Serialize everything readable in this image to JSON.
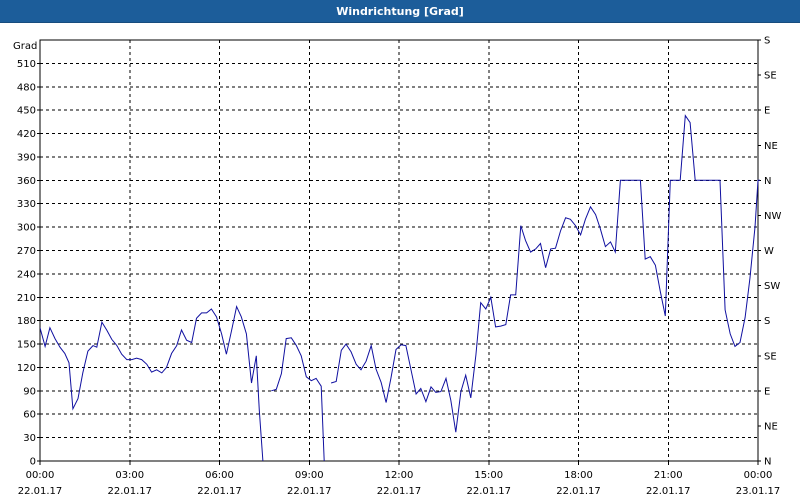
{
  "window": {
    "title": "Windrichtung [Grad]"
  },
  "chart_data": {
    "type": "line",
    "title": "Windrichtung [Grad]",
    "ylabel": "Grad",
    "xlim": [
      "22.01.17 00:00",
      "23.01.17 00:00"
    ],
    "ylim": [
      0,
      540
    ],
    "yticks": [
      0,
      30,
      60,
      90,
      120,
      150,
      180,
      210,
      240,
      270,
      300,
      330,
      360,
      390,
      420,
      450,
      480,
      510
    ],
    "y2ticks": [
      {
        "value": 0,
        "label": "N"
      },
      {
        "value": 45,
        "label": "NE"
      },
      {
        "value": 90,
        "label": "E"
      },
      {
        "value": 135,
        "label": "SE"
      },
      {
        "value": 180,
        "label": "S"
      },
      {
        "value": 225,
        "label": "SW"
      },
      {
        "value": 270,
        "label": "W"
      },
      {
        "value": 315,
        "label": "NW"
      },
      {
        "value": 360,
        "label": "N"
      },
      {
        "value": 405,
        "label": "NE"
      },
      {
        "value": 450,
        "label": "E"
      },
      {
        "value": 495,
        "label": "SE"
      },
      {
        "value": 540,
        "label": "S"
      }
    ],
    "xticks": [
      {
        "hour": 0,
        "time": "00:00",
        "date": "22.01.17"
      },
      {
        "hour": 3,
        "time": "03:00",
        "date": "22.01.17"
      },
      {
        "hour": 6,
        "time": "06:00",
        "date": "22.01.17"
      },
      {
        "hour": 9,
        "time": "09:00",
        "date": "22.01.17"
      },
      {
        "hour": 12,
        "time": "12:00",
        "date": "22.01.17"
      },
      {
        "hour": 15,
        "time": "15:00",
        "date": "22.01.17"
      },
      {
        "hour": 18,
        "time": "18:00",
        "date": "22.01.17"
      },
      {
        "hour": 21,
        "time": "21:00",
        "date": "22.01.17"
      },
      {
        "hour": 24,
        "time": "00:00",
        "date": "23.01.17"
      }
    ],
    "grid": true,
    "line_color": "#1010a0",
    "series": [
      {
        "segments": [
          [
            [
              0.0,
              171
            ],
            [
              0.17,
              147
            ],
            [
              0.33,
              171
            ],
            [
              0.5,
              157
            ],
            [
              0.67,
              146
            ],
            [
              0.83,
              138
            ],
            [
              0.97,
              126
            ],
            [
              1.1,
              67
            ],
            [
              1.27,
              80
            ],
            [
              1.43,
              113
            ],
            [
              1.6,
              141
            ],
            [
              1.77,
              148
            ],
            [
              1.9,
              146
            ],
            [
              2.07,
              178
            ],
            [
              2.23,
              168
            ],
            [
              2.4,
              156
            ],
            [
              2.57,
              148
            ],
            [
              2.73,
              137
            ],
            [
              2.9,
              130
            ],
            [
              3.07,
              130
            ],
            [
              3.23,
              132
            ],
            [
              3.4,
              130
            ],
            [
              3.57,
              124
            ],
            [
              3.73,
              114
            ],
            [
              3.9,
              117
            ],
            [
              4.07,
              113
            ],
            [
              4.23,
              120
            ],
            [
              4.4,
              138
            ],
            [
              4.57,
              148
            ],
            [
              4.73,
              168
            ],
            [
              4.9,
              155
            ],
            [
              5.07,
              152
            ],
            [
              5.23,
              183
            ],
            [
              5.4,
              190
            ],
            [
              5.57,
              190
            ],
            [
              5.73,
              195
            ],
            [
              5.9,
              185
            ],
            [
              6.07,
              163
            ],
            [
              6.23,
              137
            ],
            [
              6.4,
              167
            ],
            [
              6.57,
              198
            ],
            [
              6.73,
              185
            ],
            [
              6.9,
              163
            ],
            [
              7.07,
              100
            ],
            [
              7.23,
              135
            ],
            [
              7.33,
              65
            ],
            [
              7.45,
              0
            ]
          ],
          [
            [
              7.73,
              90
            ],
            [
              7.9,
              92
            ],
            [
              8.07,
              112
            ],
            [
              8.23,
              157
            ],
            [
              8.4,
              158
            ],
            [
              8.57,
              148
            ],
            [
              8.73,
              135
            ],
            [
              8.9,
              108
            ],
            [
              9.07,
              103
            ],
            [
              9.23,
              106
            ],
            [
              9.4,
              96
            ],
            [
              9.5,
              0
            ]
          ],
          [
            [
              9.73,
              100
            ],
            [
              9.9,
              102
            ],
            [
              10.07,
              142
            ],
            [
              10.23,
              150
            ],
            [
              10.4,
              140
            ],
            [
              10.57,
              124
            ],
            [
              10.73,
              117
            ],
            [
              10.9,
              128
            ],
            [
              11.07,
              148
            ],
            [
              11.23,
              118
            ],
            [
              11.4,
              101
            ],
            [
              11.57,
              75
            ],
            [
              11.73,
              106
            ],
            [
              11.9,
              143
            ],
            [
              12.07,
              149
            ],
            [
              12.23,
              148
            ],
            [
              12.4,
              117
            ],
            [
              12.57,
              86
            ],
            [
              12.73,
              93
            ],
            [
              12.9,
              76
            ],
            [
              13.07,
              95
            ],
            [
              13.23,
              88
            ],
            [
              13.4,
              89
            ],
            [
              13.57,
              106
            ],
            [
              13.73,
              78
            ],
            [
              13.9,
              37
            ],
            [
              14.07,
              89
            ],
            [
              14.23,
              110
            ],
            [
              14.4,
              81
            ],
            [
              14.57,
              136
            ],
            [
              14.73,
              203
            ],
            [
              14.9,
              195
            ],
            [
              15.07,
              210
            ],
            [
              15.23,
              172
            ],
            [
              15.4,
              173
            ],
            [
              15.57,
              175
            ],
            [
              15.73,
              213
            ],
            [
              15.9,
              213
            ],
            [
              16.07,
              302
            ],
            [
              16.23,
              283
            ],
            [
              16.4,
              268
            ],
            [
              16.57,
              272
            ],
            [
              16.73,
              279
            ],
            [
              16.9,
              248
            ],
            [
              17.07,
              272
            ],
            [
              17.23,
              273
            ],
            [
              17.4,
              295
            ],
            [
              17.57,
              312
            ],
            [
              17.73,
              310
            ],
            [
              17.9,
              302
            ],
            [
              18.07,
              290
            ],
            [
              18.23,
              310
            ],
            [
              18.4,
              326
            ],
            [
              18.57,
              316
            ],
            [
              18.73,
              298
            ],
            [
              18.9,
              275
            ],
            [
              19.07,
              281
            ],
            [
              19.23,
              268
            ],
            [
              19.4,
              360
            ],
            [
              19.57,
              360
            ],
            [
              19.73,
              360
            ],
            [
              19.9,
              360
            ],
            [
              20.07,
              360
            ],
            [
              20.23,
              259
            ],
            [
              20.4,
              262
            ],
            [
              20.57,
              251
            ],
            [
              20.73,
              218
            ],
            [
              20.9,
              186
            ],
            [
              21.07,
              360
            ],
            [
              21.23,
              360
            ],
            [
              21.4,
              360
            ],
            [
              21.57,
              443
            ],
            [
              21.73,
              434
            ],
            [
              21.9,
              360
            ],
            [
              22.07,
              360
            ],
            [
              22.23,
              360
            ],
            [
              22.4,
              360
            ],
            [
              22.57,
              360
            ],
            [
              22.73,
              360
            ],
            [
              22.9,
              194
            ],
            [
              23.07,
              163
            ],
            [
              23.23,
              147
            ],
            [
              23.4,
              152
            ],
            [
              23.57,
              184
            ],
            [
              23.73,
              234
            ],
            [
              23.9,
              300
            ],
            [
              24.0,
              360
            ],
            [
              24.3,
              360
            ]
          ]
        ]
      }
    ]
  }
}
